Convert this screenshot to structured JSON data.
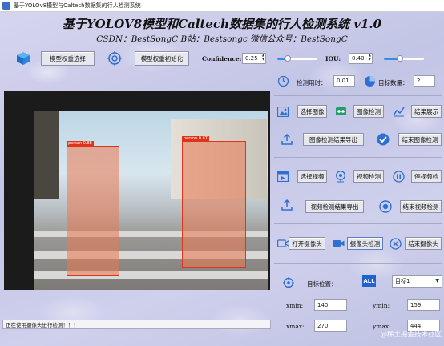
{
  "window": {
    "title": "基于YOLOv8模型与Caltech数据集的行人检测系统"
  },
  "header": {
    "title": "基于YOLOV8模型和Caltech数据集的行人检测系统 v1.0",
    "subtitle": "CSDN：BestSongC   B站：Bestsongc   微信公众号：BestSongC"
  },
  "toolbar": {
    "select_model": "模型权重选择",
    "init_model": "模型权重初始化",
    "confidence_label": "Confidence:",
    "confidence_value": "0.25",
    "confidence_level": 0.25,
    "iou_label": "IOU:",
    "iou_value": "0.40",
    "iou_level": 0.4
  },
  "stats": {
    "time_label": "检测用时：",
    "time_value": "0.01",
    "count_label": "目标数量：",
    "count_value": "2"
  },
  "image_section": {
    "select": "选择图像",
    "detect": "图像检测",
    "show_result": "结果展示",
    "export": "图像检测结果导出",
    "stop": "结束图像检测"
  },
  "video_section": {
    "select": "选择视频",
    "detect": "视频检测",
    "pause": "停视频检",
    "export": "视频检测结果导出",
    "stop": "结束视频检测"
  },
  "camera_section": {
    "open": "打开摄像头",
    "detect": "摄像头检测",
    "close": "结束摄像头"
  },
  "position": {
    "label": "目标位置：",
    "target_select": "目标1",
    "xmin_label": "xmin:",
    "xmin": "140",
    "ymin_label": "ymin:",
    "ymin": "159",
    "xmax_label": "xmax:",
    "xmax": "270",
    "ymax_label": "ymax:",
    "ymax": "444"
  },
  "detections": [
    {
      "label": "person 0.88"
    },
    {
      "label": "person 0.87"
    }
  ],
  "status": {
    "text": "正在使用摄像头进行检测！！！"
  },
  "watermark": "@稀土掘金技术社区",
  "colors": {
    "accent": "#2f8fe8",
    "box": "#e0341a",
    "bg": "#c9cbe8"
  }
}
